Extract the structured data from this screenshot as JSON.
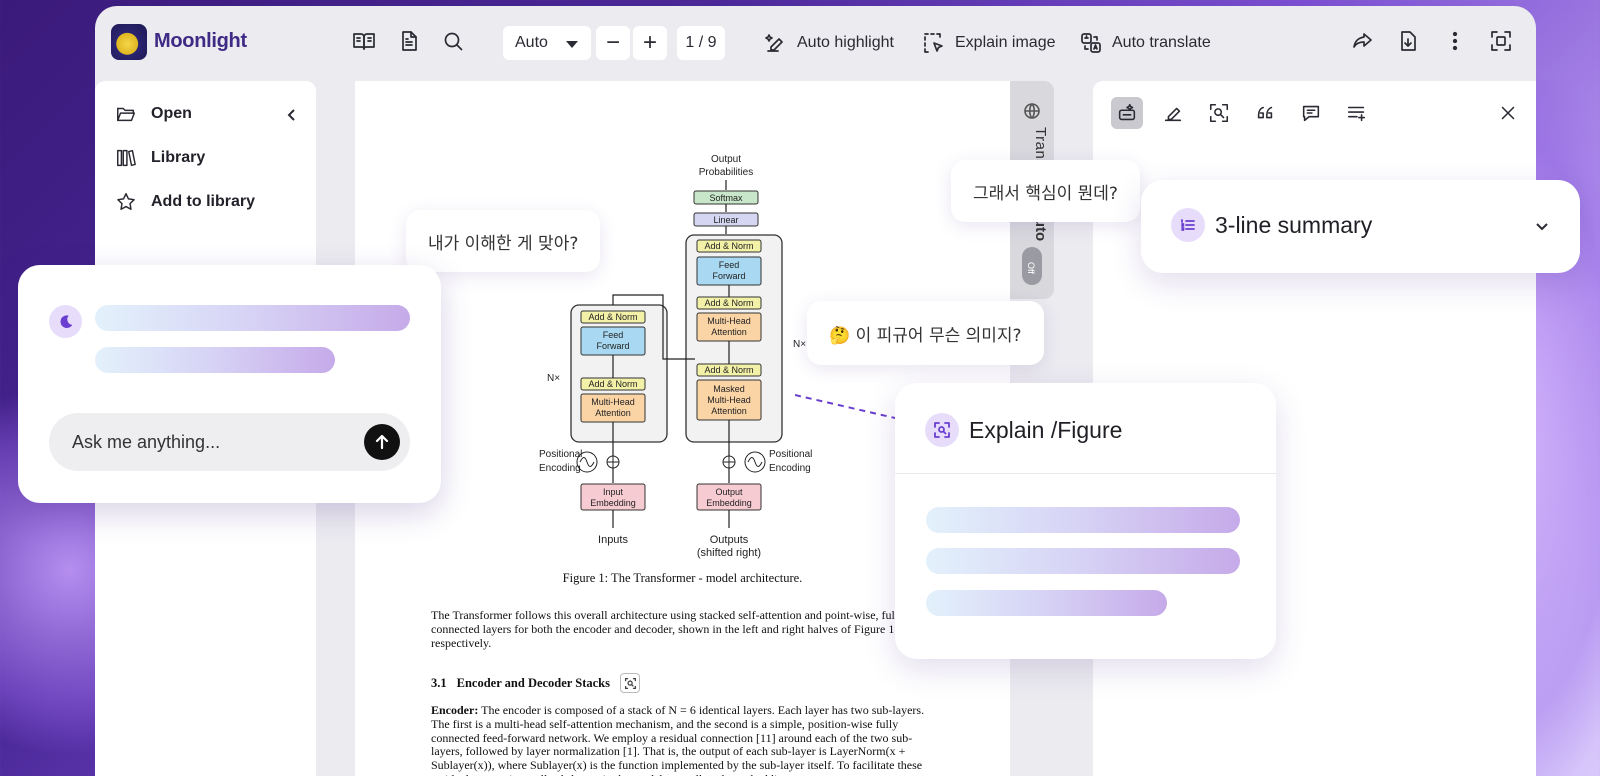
{
  "app": {
    "name": "Moonlight"
  },
  "toolbar": {
    "zoom_value": "Auto",
    "zoom_out_label": "−",
    "zoom_in_label": "+",
    "page_indicator": "1 / 9",
    "auto_highlight": "Auto highlight",
    "explain_image": "Explain image",
    "auto_translate": "Auto translate",
    "icons": [
      "book-open-icon",
      "document-icon",
      "search-icon",
      "share-icon",
      "download-icon",
      "more-vertical-icon",
      "fullscreen-icon"
    ]
  },
  "sidebar": {
    "items": [
      {
        "label": "Open",
        "icon": "folder-open-icon"
      },
      {
        "label": "Library",
        "icon": "library-icon"
      },
      {
        "label": "Add to library",
        "icon": "star-icon"
      }
    ]
  },
  "document": {
    "figure": {
      "caption": "Figure 1: The Transformer - model architecture.",
      "labels": {
        "output_probabilities_1": "Output",
        "output_probabilities_2": "Probabilities",
        "softmax": "Softmax",
        "linear": "Linear",
        "add_norm": "Add & Norm",
        "feed": "Feed",
        "forward": "Forward",
        "multi_head": "Multi-Head",
        "attention": "Attention",
        "masked": "Masked",
        "nx": "N×",
        "positional": "Positional",
        "encoding": "Encoding",
        "input": "Input",
        "embedding": "Embedding",
        "output": "Output",
        "inputs": "Inputs",
        "outputs": "Outputs",
        "shifted_right": "(shifted right)"
      }
    },
    "paragraph1": "The Transformer follows this overall architecture using stacked self-attention and point-wise, fully connected layers for both the encoder and decoder, shown in the left and right halves of Figure 1, respectively.",
    "section_number": "3.1",
    "section_title": "Encoder and Decoder Stacks",
    "encoder_label": "Encoder:",
    "encoder_text": "The encoder is composed of a stack of N = 6 identical layers. Each layer has two sub-layers. The first is a multi-head self-attention mechanism, and the second is a simple, position-wise fully connected feed-forward network. We employ a residual connection [11] around each of the two sub-layers, followed by layer normalization [1]. That is, the output of each sub-layer is LayerNorm(x + Sublayer(x)), where Sublayer(x) is the function implemented by the sub-layer itself. To facilitate these residual connections, all sub-layers in the model, as well as the embedding"
  },
  "translate_strip": {
    "label": "Translate",
    "mode": "Auto",
    "toggle": "Off"
  },
  "right_panel": {
    "icons": [
      "ai-sparkle-icon",
      "highlighter-icon",
      "image-search-icon",
      "quote-icon",
      "comment-icon",
      "list-add-icon",
      "close-icon"
    ]
  },
  "bubbles": {
    "understand": "내가 이해한 게 맞아?",
    "core": "그래서 핵심이 뭔데?",
    "figure_meaning": "🤔 이 피규어 무슨 의미지?"
  },
  "chat": {
    "placeholder": "Ask me anything..."
  },
  "explain_card": {
    "title": "Explain /Figure"
  },
  "summary_card": {
    "title": "3-line summary"
  },
  "colors": {
    "brand": "#3f2a86",
    "accent": "#6a3fd0"
  }
}
